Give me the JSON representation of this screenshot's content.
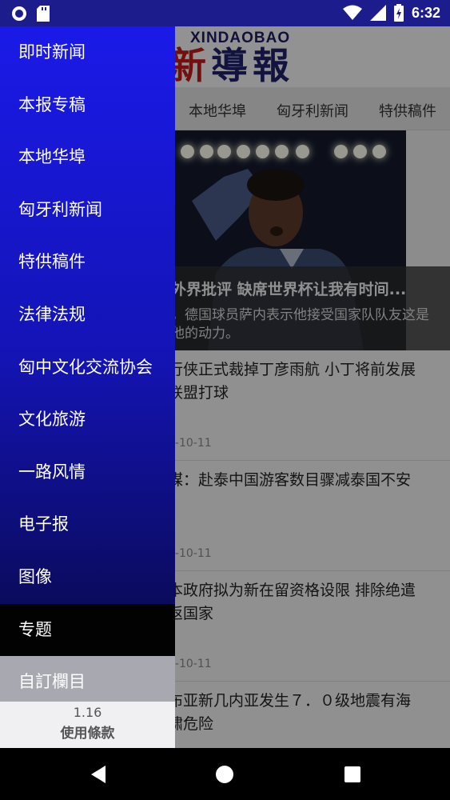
{
  "status_bar": {
    "time": "6:32",
    "icons": [
      "circle-notification-icon",
      "sd-card-icon",
      "wifi-icon",
      "signal-icon",
      "battery-charging-icon"
    ],
    "background_color": "#1c1c8c"
  },
  "masthead": {
    "latin": "XINDAOBAO",
    "chinese_first": "新",
    "chinese_rest": "導報"
  },
  "category_tabs": [
    "本地华埠",
    "匈牙利新闻",
    "特供稿件"
  ],
  "hero": {
    "title": "外界批评 缺席世界杯让我有时间...",
    "description": "，德国球员萨内表示他接受国家队队友这是他的动力。"
  },
  "news": [
    {
      "title": "行侠正式裁掉丁彦雨航 小丁将前发展联盟打球",
      "date": "3-10-11"
    },
    {
      "title": "媒：赴泰中国游客数目骤减泰国不安",
      "date": "3-10-11"
    },
    {
      "title": "本政府拟为新在留资格设限 排除绝遣返国家",
      "date": "3-10-11"
    },
    {
      "title": "布亚新几内亚发生７．０级地震有海啸危险",
      "date": ""
    }
  ],
  "drawer": {
    "items": [
      {
        "label": "即时新闻"
      },
      {
        "label": "本报专稿"
      },
      {
        "label": "本地华埠"
      },
      {
        "label": "匈牙利新闻"
      },
      {
        "label": "特供稿件"
      },
      {
        "label": "法律法规"
      },
      {
        "label": "匈中文化交流协会"
      },
      {
        "label": "文化旅游"
      },
      {
        "label": "一路风情"
      },
      {
        "label": "电子报"
      },
      {
        "label": "图像"
      },
      {
        "label": "专题"
      },
      {
        "label": "自訂欄目"
      }
    ],
    "version": "1.16",
    "terms_label": "使用條款",
    "gradient_colors": [
      "#1a1ae8",
      "#060640"
    ]
  },
  "nav_bar": {
    "icons": [
      "back-icon",
      "home-icon",
      "recents-icon"
    ]
  }
}
